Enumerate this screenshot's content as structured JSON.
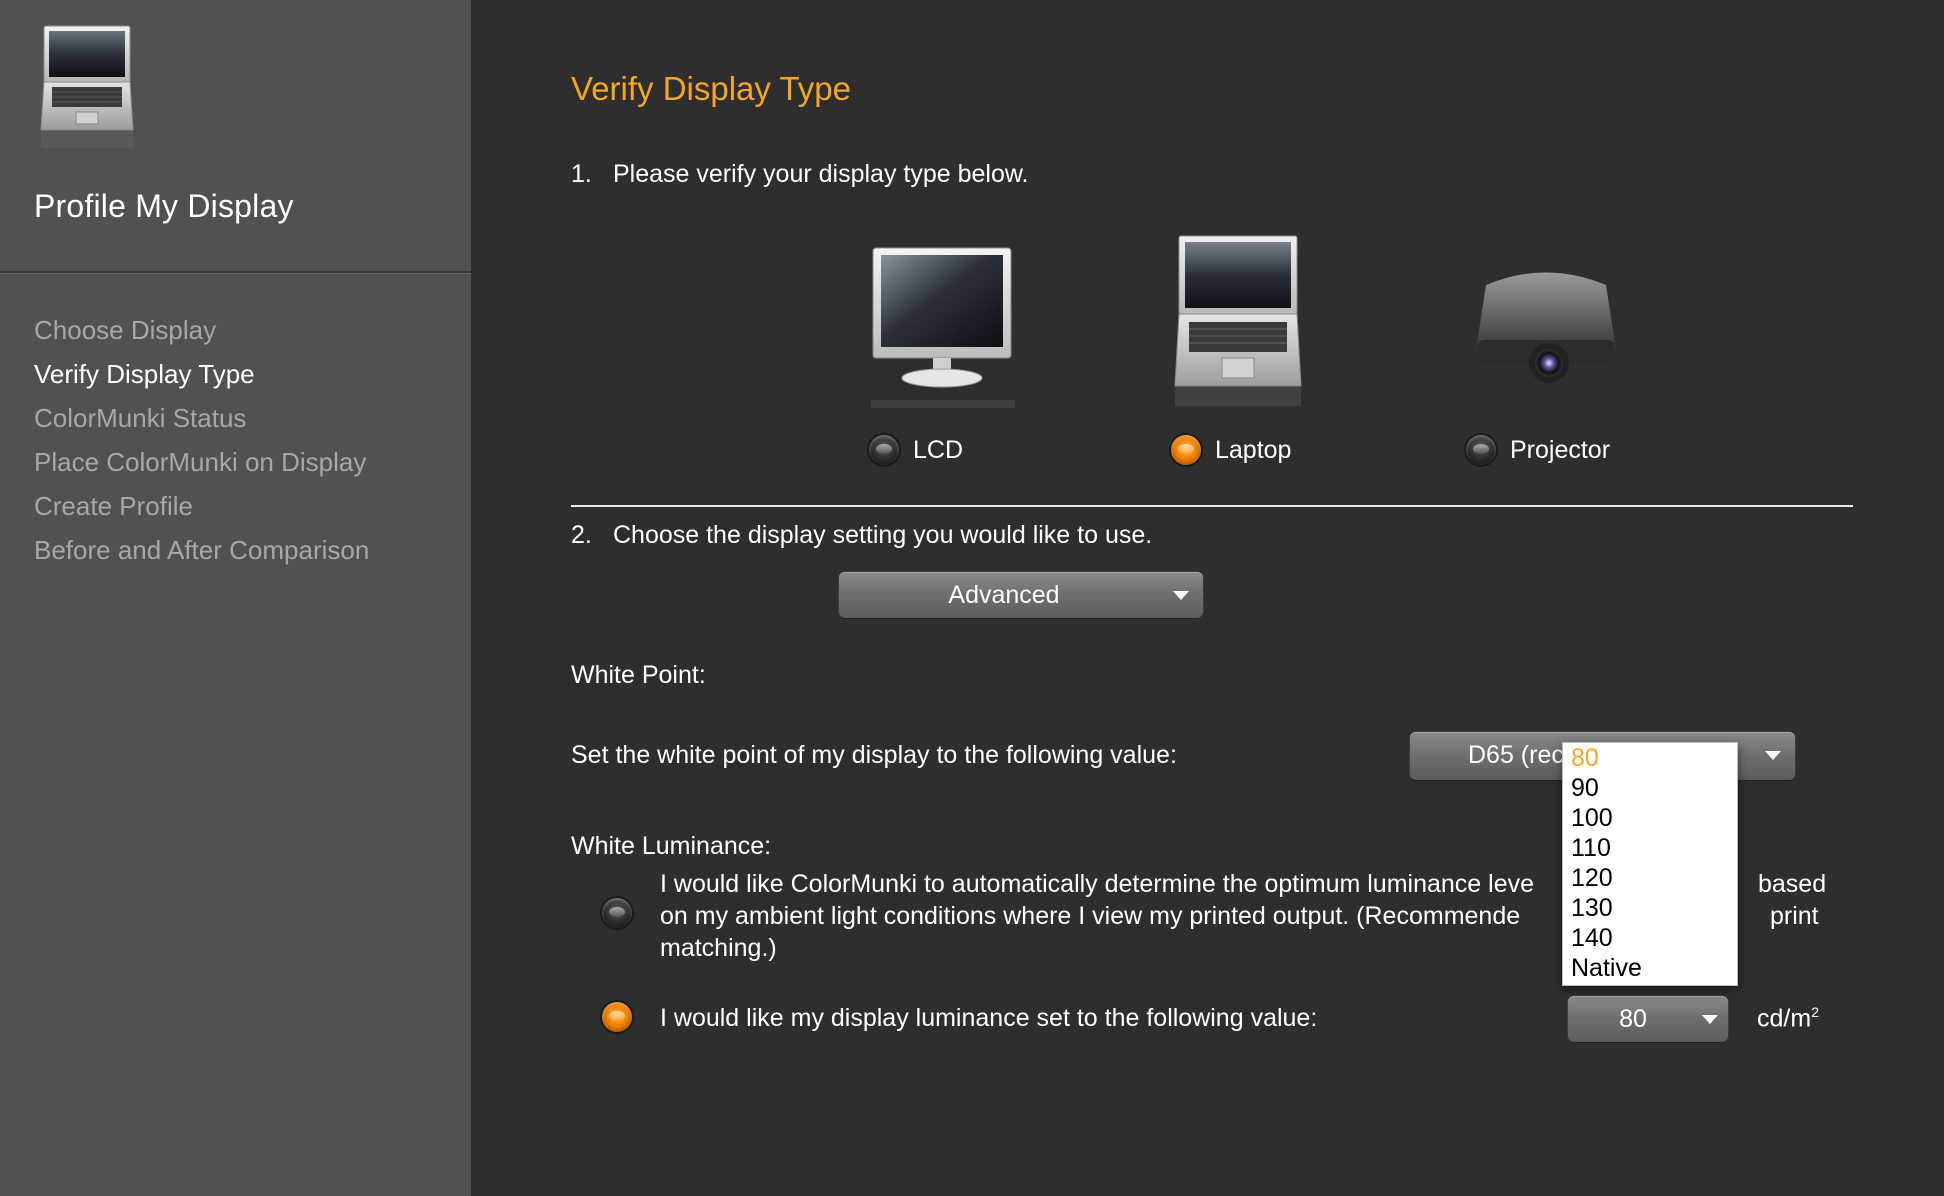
{
  "sidebar": {
    "title": "Profile My Display",
    "steps": [
      {
        "label": "Choose Display",
        "active": false
      },
      {
        "label": "Verify Display Type",
        "active": true
      },
      {
        "label": "ColorMunki Status",
        "active": false
      },
      {
        "label": "Place ColorMunki on Display",
        "active": false
      },
      {
        "label": "Create Profile",
        "active": false
      },
      {
        "label": "Before and After Comparison",
        "active": false
      }
    ]
  },
  "main": {
    "title": "Verify Display Type",
    "step1": {
      "number": "1.",
      "text": "Please verify your display type below."
    },
    "display_types": [
      {
        "label": "LCD",
        "icon": "lcd-monitor-icon",
        "selected": false
      },
      {
        "label": "Laptop",
        "icon": "laptop-icon",
        "selected": true
      },
      {
        "label": "Projector",
        "icon": "projector-icon",
        "selected": false
      }
    ],
    "step2": {
      "number": "2.",
      "text": "Choose the display setting you would like to use."
    },
    "setting_dropdown": {
      "value": "Advanced"
    },
    "white_point": {
      "heading": "White Point:",
      "label": "Set the white point of my display to the following value:",
      "dropdown_value": "D65 (rec"
    },
    "white_luminance": {
      "heading": "White Luminance:",
      "auto_option": {
        "line1": "I would like ColorMunki to automatically determine the optimum luminance leve",
        "line1_right": "based",
        "line2": "on my ambient light conditions where I view my printed output.  (Recommende",
        "line2_right": "print",
        "line3": "matching.)",
        "selected": false
      },
      "manual_option": {
        "text": "I would like my display luminance set to the following value:",
        "selected": true
      },
      "luminance_dropdown": {
        "value": "80"
      },
      "unit": "cd/m",
      "unit_sup": "2",
      "popup_options": [
        "80",
        "90",
        "100",
        "110",
        "120",
        "130",
        "140",
        "Native"
      ],
      "popup_selected": "80"
    }
  },
  "colors": {
    "accent": "#f6a623",
    "sidebar_bg": "#515151",
    "main_bg": "#2e2e2e"
  }
}
